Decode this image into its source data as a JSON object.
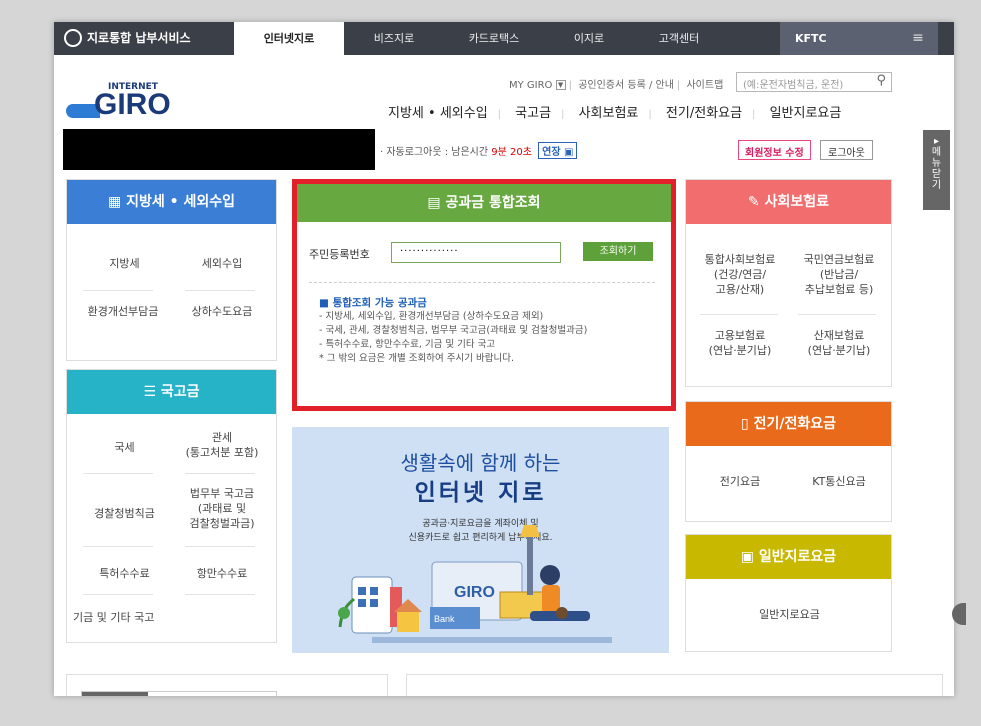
{
  "topbar": {
    "brand": "지로통합 납부서비스",
    "tabs": [
      "인터넷지로",
      "비즈지로",
      "카드로택스",
      "이지로",
      "고객센터"
    ],
    "kftc": "KFTC",
    "menu_icon": "≡"
  },
  "logo": {
    "small": "INTERNET",
    "big": "GIRO"
  },
  "utility": {
    "links": [
      "MY GIRO",
      "공인인증서 등록 / 안내",
      "사이트맵"
    ],
    "search_placeholder": "(예:운전자범칙금, 운전)"
  },
  "mainnav": [
    "지방세 • 세외수입",
    "국고금",
    "사회보험료",
    "전기/전화요금",
    "일반지로요금"
  ],
  "session": {
    "label": "· 자동로그아웃 : 남은시간",
    "time": "9분 20초",
    "extend": "연장",
    "member_info": "회원정보 수정",
    "logout": "로그아웃"
  },
  "local_tax": {
    "title": "지방세 • 세외수입",
    "items": [
      "지방세",
      "세외수입",
      "환경개선부담금",
      "상하수도요금"
    ]
  },
  "national": {
    "title": "국고금",
    "items": [
      "국세",
      "관세\n(통고처분 포함)",
      "경찰청범칙금",
      "법무부 국고금\n(과태료 및\n검찰청벌과금)",
      "특허수수료",
      "항만수수료",
      "기금 및 기타 국고"
    ]
  },
  "unified": {
    "title": "공과금 통합조회",
    "label": "주민등록번호",
    "value": "··············",
    "button": "조회하기",
    "note_title": "■ 통합조회 가능 공과금",
    "notes": [
      "- 지방세, 세외수입, 환경개선부담금 (상하수도요금 제외)",
      "- 국세, 관세, 경찰청범칙금, 법무부 국고금(과태료 및 검찰청벌과금)",
      "- 특허수수료, 항만수수료, 기금 및 기타 국고",
      "* 그 밖의 요금은 개별 조회하여 주시기 바랍니다."
    ]
  },
  "banner": {
    "line1": "생활속에 함께 하는",
    "line2": "인터넷 지로",
    "sub1": "공과금·지로요금을 계좌이체 및",
    "sub2": "신용카드로 쉽고 편리하게 납부하세요.",
    "illustration_logo": "GIRO",
    "bank": "Bank"
  },
  "social": {
    "title": "사회보험료",
    "items": [
      "통합사회보험료\n(건강/연금/\n고용/산재)",
      "국민연금보험료\n(반납금/\n추납보험료 등)",
      "고용보험료\n(연납·분기납)",
      "산재보험료\n(연납·분기납)"
    ]
  },
  "electric": {
    "title": "전기/전화요금",
    "items": [
      "전기요금",
      "KT통신요금"
    ]
  },
  "general": {
    "title": "일반지로요금",
    "items": [
      "일반지로요금"
    ]
  },
  "side_menu": "메뉴닫기",
  "colors": {
    "local": "#3a7fd5",
    "national": "#27b3c7",
    "unified": "#68a840",
    "social": "#f26d6d",
    "electric": "#e86a1a",
    "general": "#c9b800"
  }
}
